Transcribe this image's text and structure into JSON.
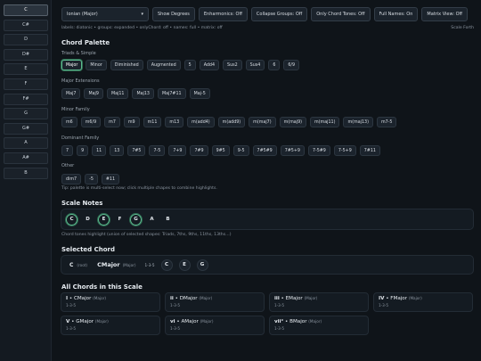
{
  "sidebar": {
    "notes": [
      "C",
      "C#",
      "D",
      "D#",
      "E",
      "F",
      "F#",
      "G",
      "G#",
      "A",
      "A#",
      "B"
    ],
    "active": "C"
  },
  "toolbar": {
    "scale_select": "Ionian (Major)",
    "show_degrees": "Show Degrees",
    "enharmonics": "Enharmonics: Off",
    "collapse_groups": "Collapse Groups: Off",
    "only_chord_tones": "Only Chord Tones: Off",
    "full_names": "Full Names: On",
    "matrix_view": "Matrix View: Off"
  },
  "status": {
    "line": "labels: diatonic • groups: expanded • onlyChord: off • names: full • matrix: off",
    "scale_forth": "Scale Forth"
  },
  "palette": {
    "title": "Chord Palette",
    "groups": [
      {
        "label": "Triads & Simple",
        "chips": [
          "Major",
          "Minor",
          "Diminished",
          "Augmented",
          "5",
          "Add4",
          "Sus2",
          "Sus4",
          "6",
          "6/9"
        ]
      },
      {
        "label": "Major Extensions",
        "chips": [
          "Maj7",
          "Maj9",
          "Maj11",
          "Maj13",
          "Maj7#11",
          "Maj-5"
        ]
      },
      {
        "label": "Minor Family",
        "chips": [
          "m6",
          "m6/9",
          "m7",
          "m9",
          "m11",
          "m13",
          "m(add4)",
          "m(add9)",
          "m(maj7)",
          "m(maj9)",
          "m(maj11)",
          "m(maj13)",
          "m7-5"
        ]
      },
      {
        "label": "Dominant Family",
        "chips": [
          "7",
          "9",
          "11",
          "13",
          "7#5",
          "7-5",
          "7+9",
          "7#9",
          "9#5",
          "9-5",
          "7#5#9",
          "7#5+9",
          "7-5#9",
          "7-5+9",
          "7#11"
        ]
      },
      {
        "label": "Other",
        "chips": [
          "dim7",
          "-5",
          "#11"
        ]
      }
    ],
    "selected_chip": "Major",
    "tip": "Tip: palette is multi-select now; click multiple chapes to combine highlights."
  },
  "scale_notes": {
    "title": "Scale Notes",
    "notes": [
      "C",
      "D",
      "E",
      "F",
      "G",
      "A",
      "B"
    ],
    "highlighted": [
      "C",
      "E",
      "G"
    ],
    "caption": "Chord tones highlight (union of selected shapes: Triads, 7ths, 9ths, 11ths, 13ths…)"
  },
  "selected_chord": {
    "title": "Selected Chord",
    "root": "C",
    "root_tag": "(root)",
    "name": "CMajor",
    "quality": "(Major)",
    "formula": "1-3-5",
    "tones": [
      "C",
      "E",
      "G"
    ]
  },
  "all_chords": {
    "title": "All Chords in this Scale",
    "cards": [
      {
        "numeral": "I",
        "name": "CMajor",
        "quality": "(Major)",
        "formula": "1-3-5"
      },
      {
        "numeral": "ii",
        "name": "DMajor",
        "quality": "(Major)",
        "formula": "1-3-5"
      },
      {
        "numeral": "iii",
        "name": "EMajor",
        "quality": "(Major)",
        "formula": "1-3-5"
      },
      {
        "numeral": "IV",
        "name": "FMajor",
        "quality": "(Major)",
        "formula": "1-3-5"
      },
      {
        "numeral": "V",
        "name": "GMajor",
        "quality": "(Major)",
        "formula": "1-3-5"
      },
      {
        "numeral": "vi",
        "name": "AMajor",
        "quality": "(Major)",
        "formula": "1-3-5"
      },
      {
        "numeral": "vii°",
        "name": "BMajor",
        "quality": "(Major)",
        "formula": "1-3-5"
      }
    ]
  }
}
